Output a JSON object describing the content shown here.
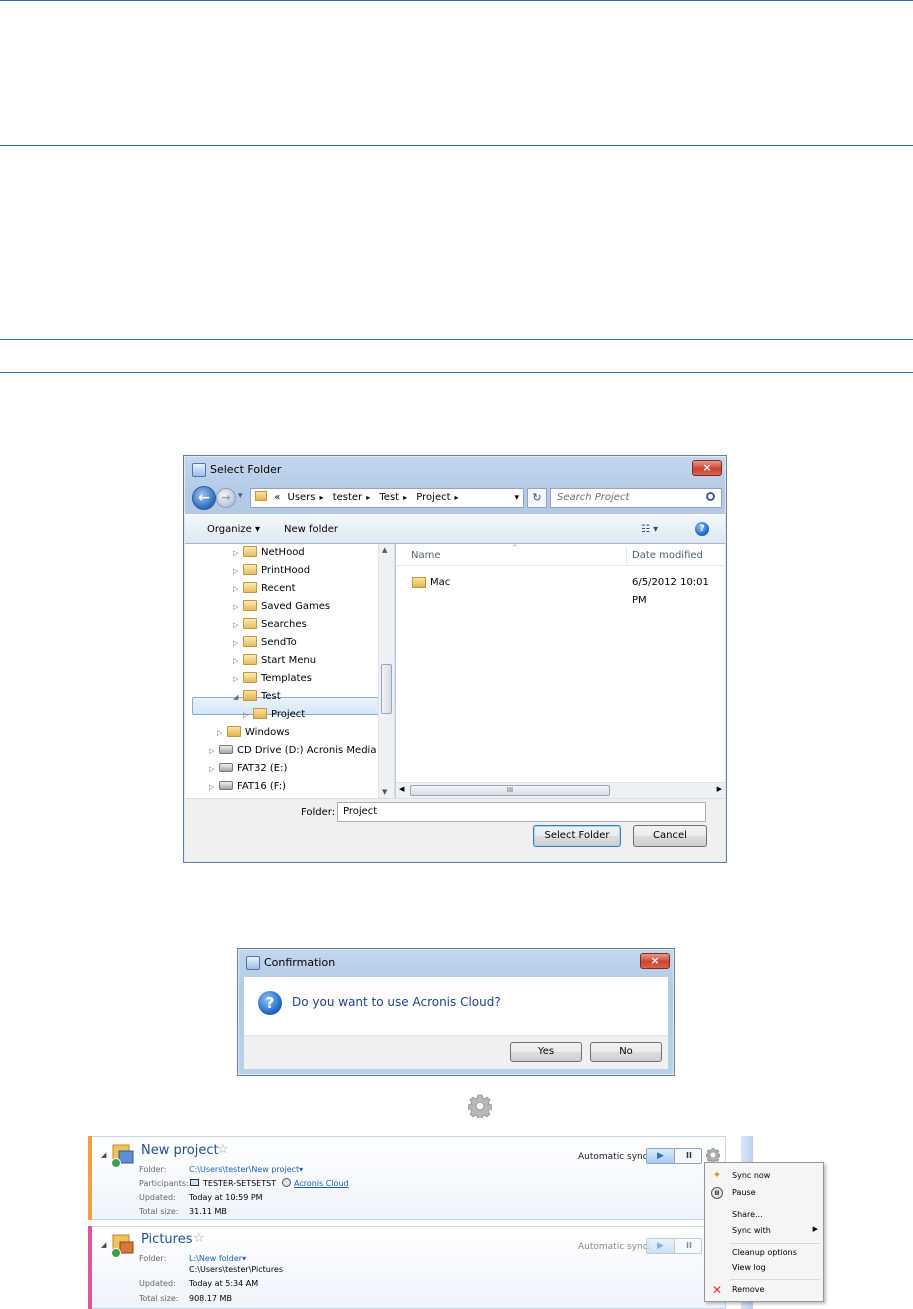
{
  "select_folder": {
    "title": "Select Folder",
    "close": "×",
    "back": "←",
    "fwd": "→",
    "nav_dropdown": "▾",
    "breadcrumb": [
      "«",
      "Users",
      "tester",
      "Test",
      "Project"
    ],
    "address_dropdown": "▾",
    "refresh": "↻",
    "search_placeholder": "Search Project",
    "toolbar": {
      "organize": "Organize ▾",
      "new_folder": "New folder",
      "view": "☷ ▾",
      "help": "?"
    },
    "tree": [
      {
        "label": "NetHood",
        "icon": "sys"
      },
      {
        "label": "PrintHood",
        "icon": "sys"
      },
      {
        "label": "Recent",
        "icon": "sys"
      },
      {
        "label": "Saved Games",
        "icon": "sys"
      },
      {
        "label": "Searches",
        "icon": "sys"
      },
      {
        "label": "SendTo",
        "icon": "sys"
      },
      {
        "label": "Start Menu",
        "icon": "sys"
      },
      {
        "label": "Templates",
        "icon": "sys"
      },
      {
        "label": "Test",
        "icon": "folder",
        "expanded": true
      },
      {
        "label": "Project",
        "icon": "folder",
        "selected": true
      },
      {
        "label": "Windows",
        "icon": "folder"
      },
      {
        "label": "CD Drive (D:) Acronis Media",
        "icon": "drive"
      },
      {
        "label": "FAT32 (E:)",
        "icon": "drive"
      },
      {
        "label": "FAT16 (F:)",
        "icon": "drive"
      }
    ],
    "columns": {
      "name": "Name",
      "date": "Date modified"
    },
    "files": [
      {
        "name": "Mac",
        "date": "6/5/2012 10:01 PM"
      }
    ],
    "folder_label": "Folder:",
    "folder_value": "Project",
    "select_button": "Select Folder",
    "cancel_button": "Cancel"
  },
  "confirmation": {
    "title": "Confirmation",
    "close": "×",
    "message": "Do you want to use Acronis Cloud?",
    "yes": "Yes",
    "no": "No"
  },
  "sync": {
    "items": [
      {
        "name": "New project",
        "accent": "#f0a040",
        "folder_label": "Folder:",
        "folder": "C:\\Users\\tester\\New project▾",
        "participants_label": "Participants:",
        "participant_computer": "TESTER-SETSETST",
        "participant_cloud": "Acronis Cloud",
        "updated_label": "Updated:",
        "updated": "Today at 10:59 PM",
        "size_label": "Total size:",
        "size": "31.11 MB",
        "auto_sync": "Automatic sync:"
      },
      {
        "name": "Pictures",
        "accent": "#e0559a",
        "folder_label": "Folder:",
        "folder": "L:\\New folder▾",
        "folder_sub": "C:\\Users\\tester\\Pictures",
        "updated_label": "Updated:",
        "updated": "Today at 5:34 AM",
        "size_label": "Total size:",
        "size": "908.17 MB",
        "auto_sync": "Automatic sync:"
      }
    ],
    "menu": [
      {
        "label": "Sync now",
        "icon": "sync-now-icon"
      },
      {
        "label": "Pause",
        "icon": "pause-icon"
      },
      {
        "label": "Share...",
        "icon": ""
      },
      {
        "label": "Sync with",
        "icon": "",
        "submenu": true
      },
      {
        "label": "Cleanup options",
        "icon": ""
      },
      {
        "label": "View log",
        "icon": ""
      },
      {
        "label": "Remove",
        "icon": "remove-icon"
      }
    ]
  }
}
